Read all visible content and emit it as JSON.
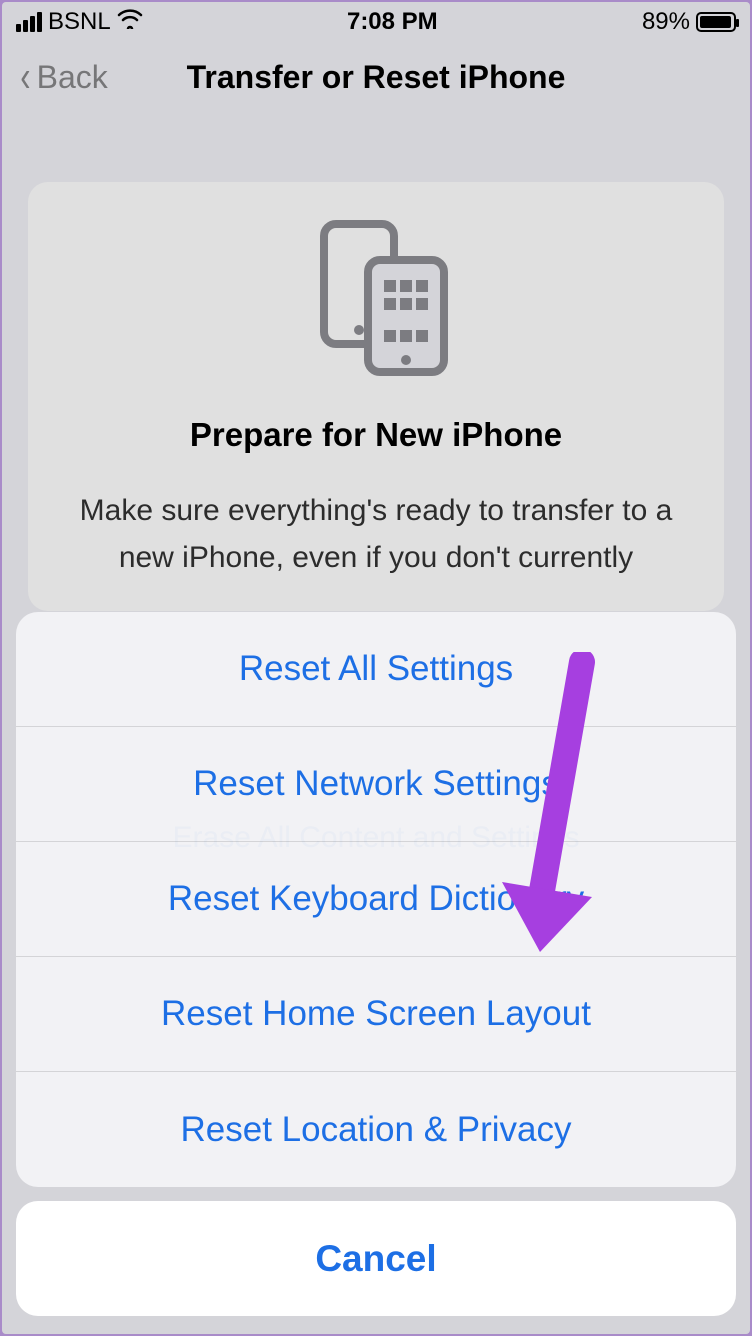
{
  "status_bar": {
    "carrier": "BSNL",
    "time": "7:08 PM",
    "battery_pct": "89%"
  },
  "nav": {
    "back_label": "Back",
    "title": "Transfer or Reset iPhone"
  },
  "card": {
    "heading": "Prepare for New iPhone",
    "body": "Make sure everything's ready to transfer to a new iPhone, even if you don't currently"
  },
  "background": {
    "erase_link": "Erase All Content and Settings"
  },
  "sheet": {
    "options": [
      "Reset All Settings",
      "Reset Network Settings",
      "Reset Keyboard Dictionary",
      "Reset Home Screen Layout",
      "Reset Location & Privacy"
    ],
    "cancel": "Cancel"
  },
  "annotation": {
    "arrow_color": "#a63fe0"
  }
}
